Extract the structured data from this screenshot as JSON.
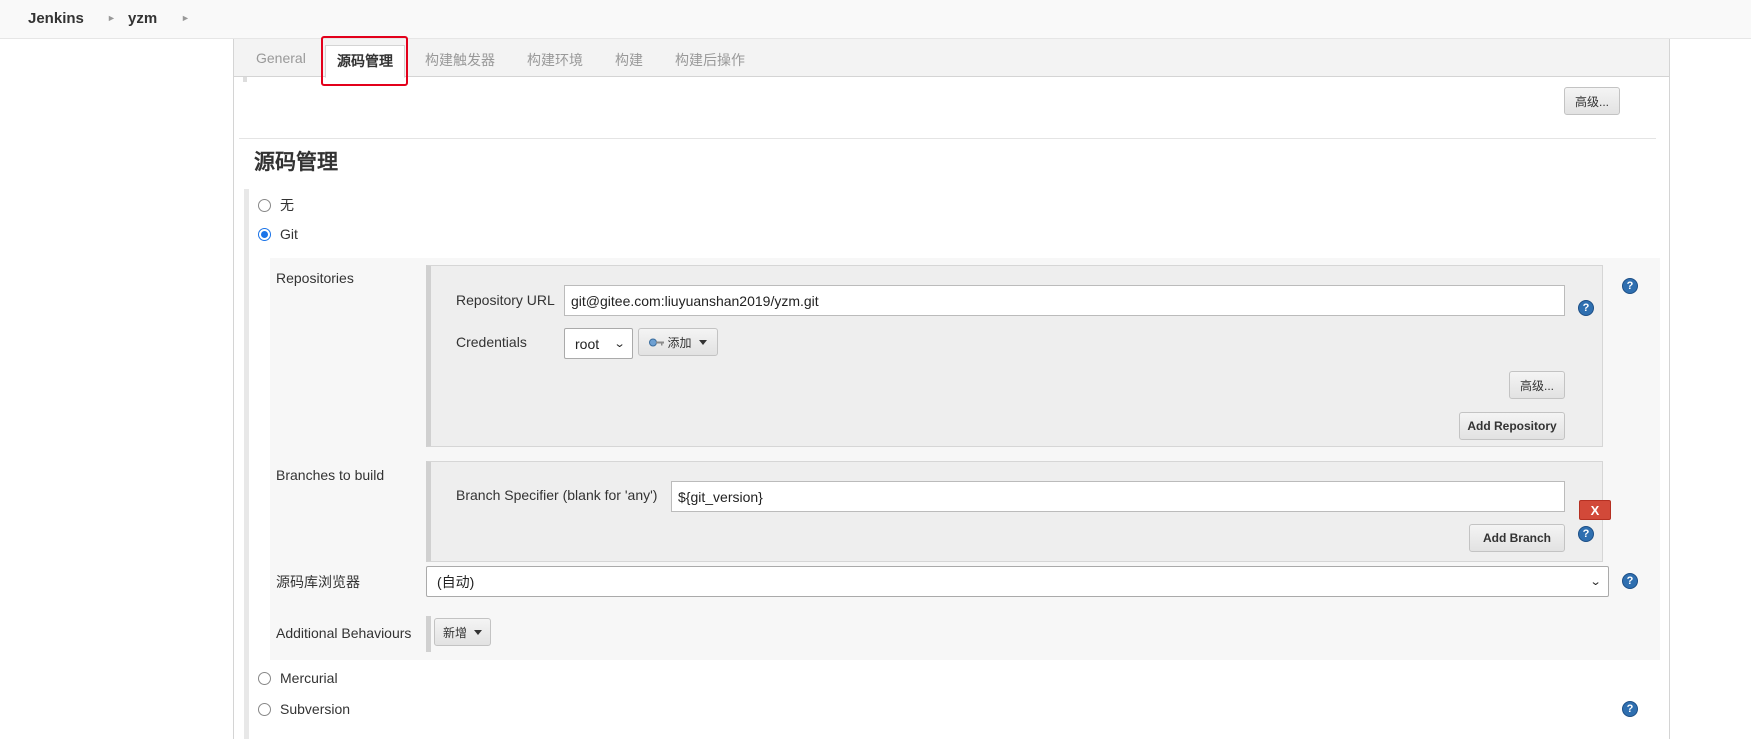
{
  "breadcrumb": {
    "items": [
      "Jenkins",
      "yzm"
    ],
    "separator": "›"
  },
  "tabs": [
    {
      "label": "General",
      "active": false
    },
    {
      "label": "源码管理",
      "active": true
    },
    {
      "label": "构建触发器",
      "active": false
    },
    {
      "label": "构建环境",
      "active": false
    },
    {
      "label": "构建",
      "active": false
    },
    {
      "label": "构建后操作",
      "active": false
    }
  ],
  "advanced_top_label": "高级...",
  "section_title": "源码管理",
  "scm_options": [
    {
      "label": "无",
      "checked": false
    },
    {
      "label": "Git",
      "checked": true
    },
    {
      "label": "Mercurial",
      "checked": false
    },
    {
      "label": "Subversion",
      "checked": false
    }
  ],
  "repositories": {
    "label": "Repositories",
    "url_label": "Repository URL",
    "url_value": "git@gitee.com:liuyuanshan2019/yzm.git",
    "credentials_label": "Credentials",
    "credentials_value": "root",
    "add_label": "添加",
    "advanced_label": "高级...",
    "add_repository_label": "Add Repository"
  },
  "branches": {
    "label": "Branches to build",
    "delete_label": "X",
    "specifier_label": "Branch Specifier (blank for 'any')",
    "specifier_value": "${git_version}",
    "add_branch_label": "Add Branch"
  },
  "repo_browser": {
    "label": "源码库浏览器",
    "value": "(自动)"
  },
  "behaviours": {
    "label": "Additional Behaviours",
    "add_label": "新增"
  },
  "help_glyph": "?",
  "colors": {
    "accent": "#1a73e8",
    "highlight": "#e3001b",
    "delete": "#d24939",
    "help": "#2f6fb0"
  }
}
